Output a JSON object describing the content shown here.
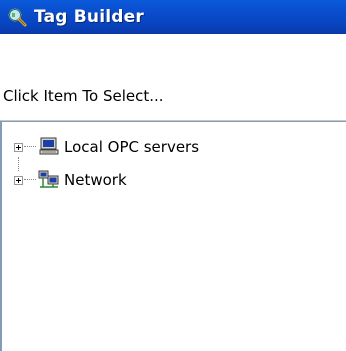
{
  "window": {
    "title": "Tag Builder",
    "title_icon": "magnifier-icon"
  },
  "prompt": {
    "text": "Click Item To Select..."
  },
  "tree": {
    "nodes": [
      {
        "label": "Local OPC servers",
        "icon": "computer-icon",
        "expander": "collapsed"
      },
      {
        "label": "Network",
        "icon": "network-icon",
        "expander": "collapsed"
      }
    ]
  },
  "colors": {
    "titlebar": "#0a4fd0",
    "title_text": "#ffffff",
    "tree_border": "#7f9db9"
  }
}
